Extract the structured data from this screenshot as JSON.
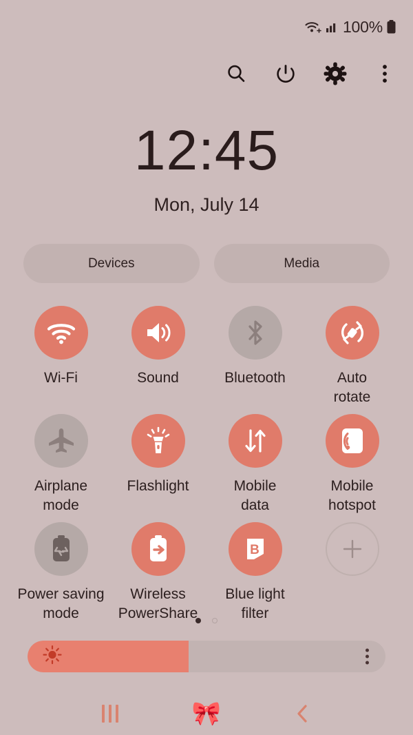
{
  "theme": {
    "background": "#cdbcbc",
    "accent_on": "#e07b6a",
    "tile_off": "#b5a9a7",
    "text": "#2b1e1e",
    "pill_bg": "#c2b2b1"
  },
  "status_bar": {
    "wifi_icon": "wifi-icon",
    "signal_icon": "cellular-signal-icon",
    "battery_text": "100%",
    "battery_icon": "battery-full-icon"
  },
  "action_row": [
    {
      "name": "search-icon",
      "label": "Search"
    },
    {
      "name": "power-icon",
      "label": "Power"
    },
    {
      "name": "gear-icon",
      "label": "Settings"
    },
    {
      "name": "overflow-menu-icon",
      "label": "More options"
    }
  ],
  "clock": {
    "time": "12:45",
    "date": "Mon, July 14"
  },
  "pills": [
    {
      "label": "Devices"
    },
    {
      "label": "Media"
    }
  ],
  "tiles": [
    {
      "label": "Wi-Fi",
      "icon": "wifi-icon",
      "state": "on"
    },
    {
      "label": "Sound",
      "icon": "sound-icon",
      "state": "on"
    },
    {
      "label": "Bluetooth",
      "icon": "bluetooth-icon",
      "state": "off"
    },
    {
      "label": "Auto\nrotate",
      "icon": "auto-rotate-icon",
      "state": "on"
    },
    {
      "label": "Airplane\nmode",
      "icon": "airplane-icon",
      "state": "off"
    },
    {
      "label": "Flashlight",
      "icon": "flashlight-icon",
      "state": "on"
    },
    {
      "label": "Mobile\ndata",
      "icon": "mobile-data-icon",
      "state": "on"
    },
    {
      "label": "Mobile\nhotspot",
      "icon": "hotspot-icon",
      "state": "on"
    },
    {
      "label": "Power saving\nmode",
      "icon": "power-saving-icon",
      "state": "off"
    },
    {
      "label": "Wireless\nPowerShare",
      "icon": "powershare-icon",
      "state": "on"
    },
    {
      "label": "Blue light\nfilter",
      "icon": "blue-light-icon",
      "state": "on"
    },
    {
      "label": "",
      "icon": "add-icon",
      "state": "add"
    }
  ],
  "page_indicator": {
    "total": 2,
    "active_index": 0
  },
  "brightness": {
    "percent": 45,
    "icon": "brightness-sun-icon",
    "menu_icon": "overflow-menu-icon"
  },
  "nav_bar": [
    {
      "name": "recents-button",
      "glyph": ""
    },
    {
      "name": "home-button",
      "glyph": "🎀"
    },
    {
      "name": "back-button",
      "glyph": ""
    }
  ]
}
